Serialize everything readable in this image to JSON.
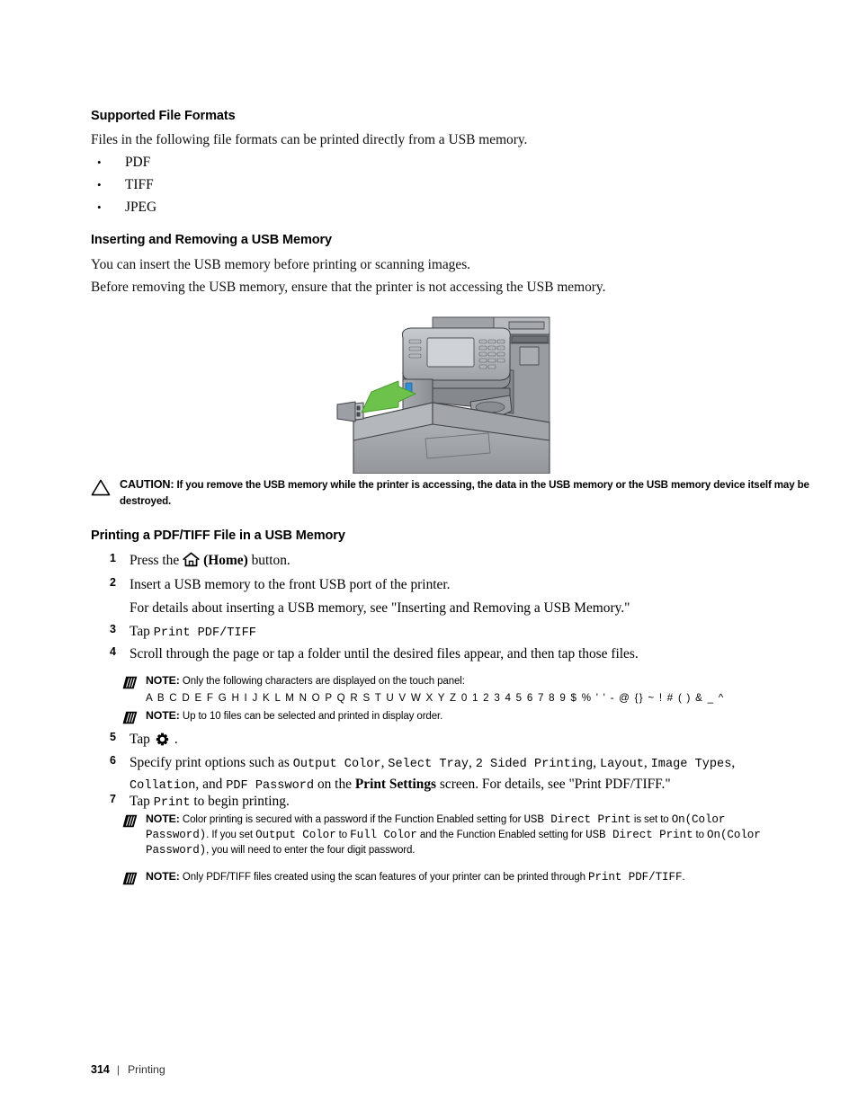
{
  "document": {
    "page_number": "314",
    "footer_separator": "|",
    "footer_section": "Printing"
  },
  "sections": [
    {
      "id": "supported-file-formats",
      "heading": "Supported File Formats",
      "intro": "Files in the following file formats can be printed directly from a USB memory.",
      "bullets": [
        "PDF",
        "TIFF",
        "JPEG"
      ],
      "bullet_glyph": "•"
    },
    {
      "id": "inserting-removing-usb",
      "heading": "Inserting and Removing a USB Memory",
      "paragraph_1": "You can insert the USB memory before printing or scanning images.",
      "paragraph_2": "Before removing the USB memory, ensure that the printer is not accessing the USB memory."
    },
    {
      "id": "printing-pdf-tiff",
      "heading": "Printing a PDF/TIFF File in a USB Memory"
    }
  ],
  "caution": {
    "icon": "warning-triangle-icon",
    "label": "CAUTION:",
    "text": " If you remove the USB memory while the printer is accessing, the data in the USB memory or the USB memory device itself may be destroyed."
  },
  "illustration": {
    "alt": "printer-usb-insertion-illustration",
    "arrow_color": "#6cc24a",
    "usb_port_color": "#2e8ed6",
    "body_color": "#9a9da1"
  },
  "steps": [
    {
      "num": "1",
      "pre": "Press the",
      "icon": "home-icon",
      "post_bold": "(Home)",
      "post": " button."
    },
    {
      "num": "2",
      "line1": "Insert a USB memory to the front USB port of the printer.",
      "line2": "For details about inserting a USB memory, see \"Inserting and Removing a USB Memory.\""
    },
    {
      "num": "3",
      "pre": "Tap ",
      "mono": "Print PDF/TIFF"
    },
    {
      "num": "4",
      "line1": "Scroll through the page or tap a folder until the desired files appear, and then tap those files."
    },
    {
      "num": "5",
      "pre": "Tap",
      "icon": "gear-icon",
      "post": "."
    },
    {
      "num": "6",
      "seg1": "Specify print options such as ",
      "mono1": "Output Color",
      "seg2": ", ",
      "mono2": "Select Tray",
      "seg3": ", ",
      "mono3": "2 Sided Printing",
      "seg4": ", ",
      "mono4": "Layout",
      "seg5": ", ",
      "mono5": "Image Types",
      "seg6": ", ",
      "mono6": "Collation",
      "seg7": ", and ",
      "mono7": "PDF Password",
      "seg8": " on the ",
      "bold1": "Print Settings",
      "seg9": " screen. For details, see \"Print PDF/TIFF.\""
    },
    {
      "num": "7",
      "pre": "Tap ",
      "mono": "Print",
      "post": " to begin printing."
    }
  ],
  "notes": [
    {
      "id": "note-characters",
      "icon": "note-pencil-icon",
      "label": "NOTE:",
      "text": " Only the following characters are displayed on the touch panel:",
      "charset": "A B C D E F G H I J K L M N O P Q R S T U V W X Y Z 0 1 2 3 4 5 6 7 8 9 $ % ' ' - @ {} ~ ! # ( ) & _ ^"
    },
    {
      "id": "note-file-limit",
      "icon": "note-pencil-icon",
      "label": "NOTE:",
      "text": " Up to 10 files can be selected and printed in display order."
    },
    {
      "id": "note-color-password",
      "icon": "note-pencil-icon",
      "label": "NOTE:",
      "seg1": " Color printing is secured with a password if the Function Enabled setting for ",
      "mono1": "USB Direct Print",
      "seg2": " is set to ",
      "mono2": "On(Color Password)",
      "seg3": ". If you set ",
      "mono3": "Output Color",
      "seg4": " to ",
      "mono4": "Full Color",
      "seg5": " and the Function Enabled setting for ",
      "mono5": "USB Direct Print",
      "seg6": " to ",
      "mono6": "On(Color Password)",
      "seg7": ", you will need to enter the four digit password."
    },
    {
      "id": "note-scan-features",
      "icon": "note-pencil-icon",
      "label": "NOTE:",
      "seg1": " Only PDF/TIFF files created using the scan features of your printer can be printed through ",
      "mono1": "Print PDF/TIFF",
      "seg2": "."
    }
  ]
}
